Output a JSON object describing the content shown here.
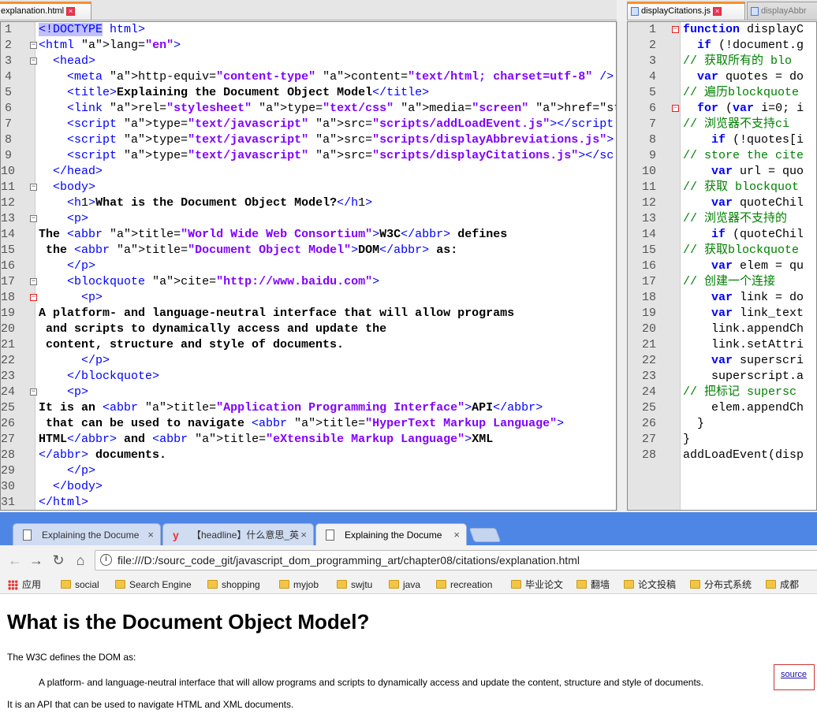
{
  "editor": {
    "left_tab": {
      "label": "explanation.html"
    },
    "right_tabs": [
      {
        "label": "displayCitations.js"
      },
      {
        "label": "displayAbbr"
      }
    ],
    "left_lines": [
      {
        "n": "1",
        "t": "<!DOCTYPE html>"
      },
      {
        "n": "2",
        "t": "<html lang=\"en\">"
      },
      {
        "n": "3",
        "t": "  <head>"
      },
      {
        "n": "4",
        "t": "    <meta http-equiv=\"content-type\" content=\"text/html; charset=utf-8\" />"
      },
      {
        "n": "5",
        "t": "    <title>Explaining the Document Object Model</title>"
      },
      {
        "n": "6",
        "t": "    <link rel=\"stylesheet\" type=\"text/css\" media=\"screen\" href=\"styles/ty"
      },
      {
        "n": "7",
        "t": "    <script type=\"text/javascript\" src=\"scripts/addLoadEvent.js\"></script"
      },
      {
        "n": "8",
        "t": "    <script type=\"text/javascript\" src=\"scripts/displayAbbreviations.js\">"
      },
      {
        "n": "9",
        "t": "    <script type=\"text/javascript\" src=\"scripts/displayCitations.js\"></sc"
      },
      {
        "n": "10",
        "t": "  </head>"
      },
      {
        "n": "11",
        "t": "  <body>"
      },
      {
        "n": "12",
        "t": "    <h1>What is the Document Object Model?</h1>"
      },
      {
        "n": "13",
        "t": "    <p>"
      },
      {
        "n": "14",
        "t": "The <abbr title=\"World Wide Web Consortium\">W3C</abbr> defines"
      },
      {
        "n": "15",
        "t": " the <abbr title=\"Document Object Model\">DOM</abbr> as:"
      },
      {
        "n": "16",
        "t": "    </p>"
      },
      {
        "n": "17",
        "t": "    <blockquote cite=\"http://www.baidu.com\">"
      },
      {
        "n": "18",
        "t": "      <p>"
      },
      {
        "n": "19",
        "t": "A platform- and language-neutral interface that will allow programs"
      },
      {
        "n": "20",
        "t": " and scripts to dynamically access and update the"
      },
      {
        "n": "21",
        "t": " content, structure and style of documents."
      },
      {
        "n": "22",
        "t": "      </p>"
      },
      {
        "n": "23",
        "t": "    </blockquote>"
      },
      {
        "n": "24",
        "t": "    <p>"
      },
      {
        "n": "25",
        "t": "It is an <abbr title=\"Application Programming Interface\">API</abbr>"
      },
      {
        "n": "26",
        "t": " that can be used to navigate <abbr title=\"HyperText Markup Language\">"
      },
      {
        "n": "27",
        "t": "HTML</abbr> and <abbr title=\"eXtensible Markup Language\">XML"
      },
      {
        "n": "28",
        "t": "</abbr> documents."
      },
      {
        "n": "29",
        "t": "    </p>"
      },
      {
        "n": "30",
        "t": "  </body>"
      },
      {
        "n": "31",
        "t": "</html>"
      }
    ],
    "right_lines": [
      {
        "n": "1",
        "t": "function displayC"
      },
      {
        "n": "2",
        "t": "  if (!document.g"
      },
      {
        "n": "3",
        "t": "// 获取所有的 blo"
      },
      {
        "n": "4",
        "t": "  var quotes = do"
      },
      {
        "n": "5",
        "t": "// 遍历blockquote"
      },
      {
        "n": "6",
        "t": "  for (var i=0; i"
      },
      {
        "n": "7",
        "t": "// 浏览器不支持ci"
      },
      {
        "n": "8",
        "t": "    if (!quotes[i"
      },
      {
        "n": "9",
        "t": "// store the cite"
      },
      {
        "n": "10",
        "t": "    var url = quo"
      },
      {
        "n": "11",
        "t": "// 获取 blockquot"
      },
      {
        "n": "12",
        "t": "    var quoteChil"
      },
      {
        "n": "13",
        "t": "// 浏览器不支持的"
      },
      {
        "n": "14",
        "t": "    if (quoteChil"
      },
      {
        "n": "15",
        "t": "// 获取blockquote"
      },
      {
        "n": "16",
        "t": "    var elem = qu"
      },
      {
        "n": "17",
        "t": "// 创建一个连接"
      },
      {
        "n": "18",
        "t": "    var link = do"
      },
      {
        "n": "19",
        "t": "    var link_text"
      },
      {
        "n": "20",
        "t": "    link.appendCh"
      },
      {
        "n": "21",
        "t": "    link.setAttri"
      },
      {
        "n": "22",
        "t": "    var superscri"
      },
      {
        "n": "23",
        "t": "    superscript.a"
      },
      {
        "n": "24",
        "t": "// 把标记 supersc"
      },
      {
        "n": "25",
        "t": "    elem.appendCh"
      },
      {
        "n": "26",
        "t": "  }"
      },
      {
        "n": "27",
        "t": "}"
      },
      {
        "n": "28",
        "t": "addLoadEvent(disp"
      }
    ]
  },
  "browser": {
    "tabs": [
      {
        "label": "Explaining the Docume",
        "icon": "page-icon"
      },
      {
        "label": "【headline】什么意思_英",
        "icon": "youdao-icon"
      },
      {
        "label": "Explaining the Docume",
        "icon": "page-icon"
      }
    ],
    "close_glyph": "×",
    "url": "file:///D:/sourc_code_git/javascript_dom_programming_art/chapter08/citations/explanation.html",
    "bookmarks": [
      "应用",
      "social",
      "Search Engine",
      "shopping",
      "myjob",
      "swjtu",
      "java",
      "recreation",
      "毕业论文",
      "翻墙",
      "论文投稿",
      "分布式系统",
      "成都"
    ],
    "page": {
      "heading": "What is the Document Object Model?",
      "intro": "The W3C defines the DOM as:",
      "blockquote": "A platform- and language-neutral interface that will allow programs and scripts to dynamically access and update the content, structure and style of documents.",
      "source_link": "source",
      "outro": "It is an API that can be used to navigate HTML and XML documents."
    }
  }
}
